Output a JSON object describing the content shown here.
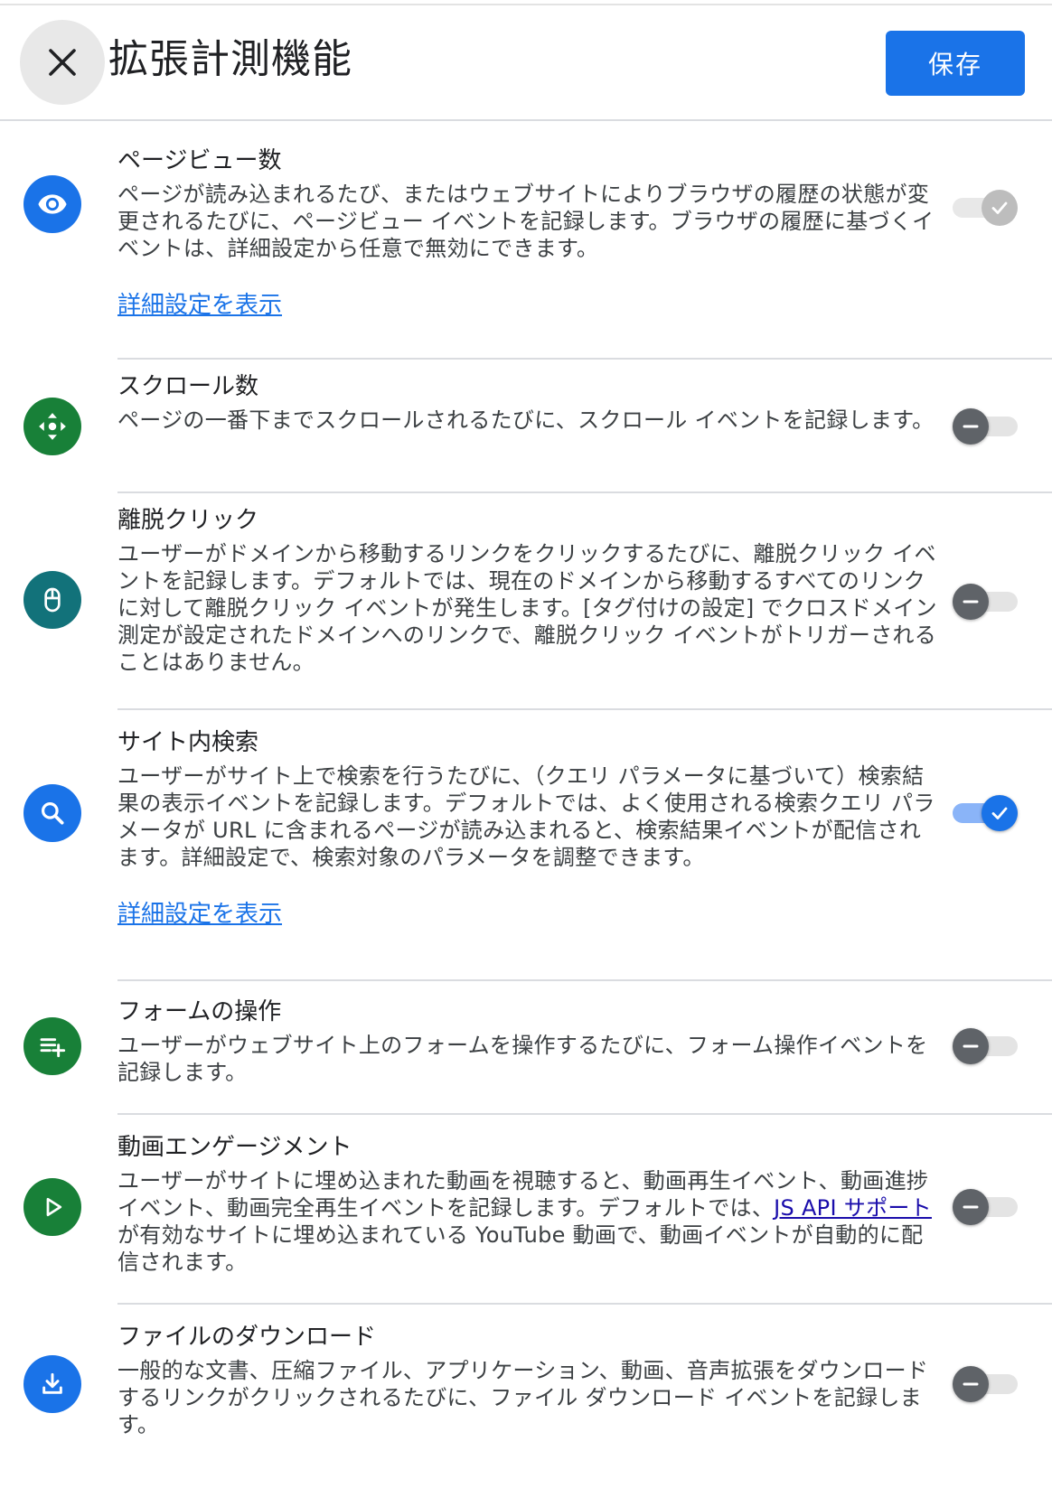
{
  "header": {
    "title": "拡張計測機能",
    "save_label": "保存"
  },
  "features": [
    {
      "title": "ページビュー数",
      "description": "ページが読み込まれるたび、またはウェブサイトによりブラウザの履歴の状態が変更されるたびに、ページビュー イベントを記録します。ブラウザの履歴に基づくイベントは、詳細設定から任意で無効にできます。",
      "advanced_link": "詳細設定を表示",
      "toggle_state": "on-disabled",
      "icon": "eye-icon",
      "icon_color": "#1a73e8"
    },
    {
      "title": "スクロール数",
      "description": "ページの一番下までスクロールされるたびに、スクロール イベントを記録します。",
      "toggle_state": "off",
      "icon": "scroll-icon",
      "icon_color": "#188038"
    },
    {
      "title": "離脱クリック",
      "description": "ユーザーがドメインから移動するリンクをクリックするたびに、離脱クリック イベントを記録します。デフォルトでは、現在のドメインから移動するすべてのリンクに対して離脱クリック イベントが発生します。[タグ付けの設定] でクロスドメイン測定が設定されたドメインへのリンクで、離脱クリック イベントがトリガーされることはありません。",
      "toggle_state": "off",
      "icon": "mouse-icon",
      "icon_color": "#12727a"
    },
    {
      "title": "サイト内検索",
      "description": "ユーザーがサイト上で検索を行うたびに、（クエリ パラメータに基づいて）検索結果の表示イベントを記録します。デフォルトでは、よく使用される検索クエリ パラメータが URL に含まれるページが読み込まれると、検索結果イベントが配信されます。詳細設定で、検索対象のパラメータを調整できます。",
      "advanced_link": "詳細設定を表示",
      "toggle_state": "on",
      "icon": "search-icon",
      "icon_color": "#1a73e8"
    },
    {
      "title": "フォームの操作",
      "description": "ユーザーがウェブサイト上のフォームを操作するたびに、フォーム操作イベントを記録します。",
      "toggle_state": "off",
      "icon": "playlist-add-icon",
      "icon_color": "#188038"
    },
    {
      "title": "動画エンゲージメント",
      "description_before": "ユーザーがサイトに埋め込まれた動画を視聴すると、動画再生イベント、動画進捗イベント、動画完全再生イベントを記録します。デフォルトでは、",
      "description_link": "JS API サポート",
      "description_after": "が有効なサイトに埋め込まれている YouTube 動画で、動画イベントが自動的に配信されます。",
      "toggle_state": "off",
      "icon": "play-icon",
      "icon_color": "#188038"
    },
    {
      "title": "ファイルのダウンロード",
      "description": "一般的な文書、圧縮ファイル、アプリケーション、動画、音声拡張をダウンロードするリンクがクリックされるたびに、ファイル ダウンロード イベントを記録します。",
      "toggle_state": "off",
      "icon": "download-icon",
      "icon_color": "#1a73e8"
    }
  ]
}
